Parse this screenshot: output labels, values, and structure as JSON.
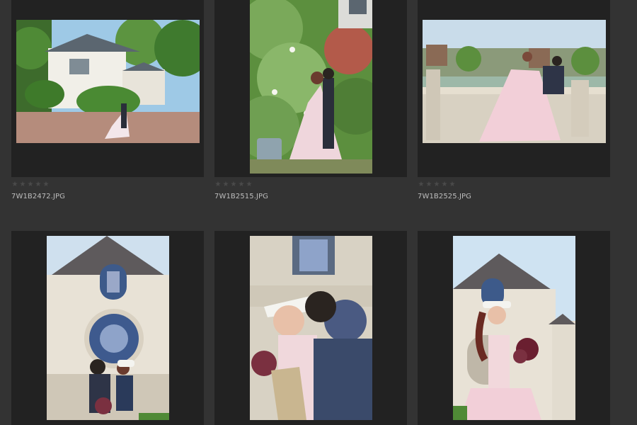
{
  "thumbnails": [
    {
      "filename": "7W1B2472.JPG",
      "rating": 0,
      "rating_max": 5
    },
    {
      "filename": "7W1B2515.JPG",
      "rating": 0,
      "rating_max": 5
    },
    {
      "filename": "7W1B2525.JPG",
      "rating": 0,
      "rating_max": 5
    },
    {
      "filename": "",
      "rating": 0,
      "rating_max": 5
    },
    {
      "filename": "",
      "rating": 0,
      "rating_max": 5
    },
    {
      "filename": "",
      "rating": 0,
      "rating_max": 5
    }
  ],
  "colors": {
    "background": "#333333",
    "frame": "#222222",
    "star_empty": "#4a4a4a",
    "filename_text": "#bdbdbd"
  },
  "icons": {
    "star": "star-outline-icon"
  }
}
